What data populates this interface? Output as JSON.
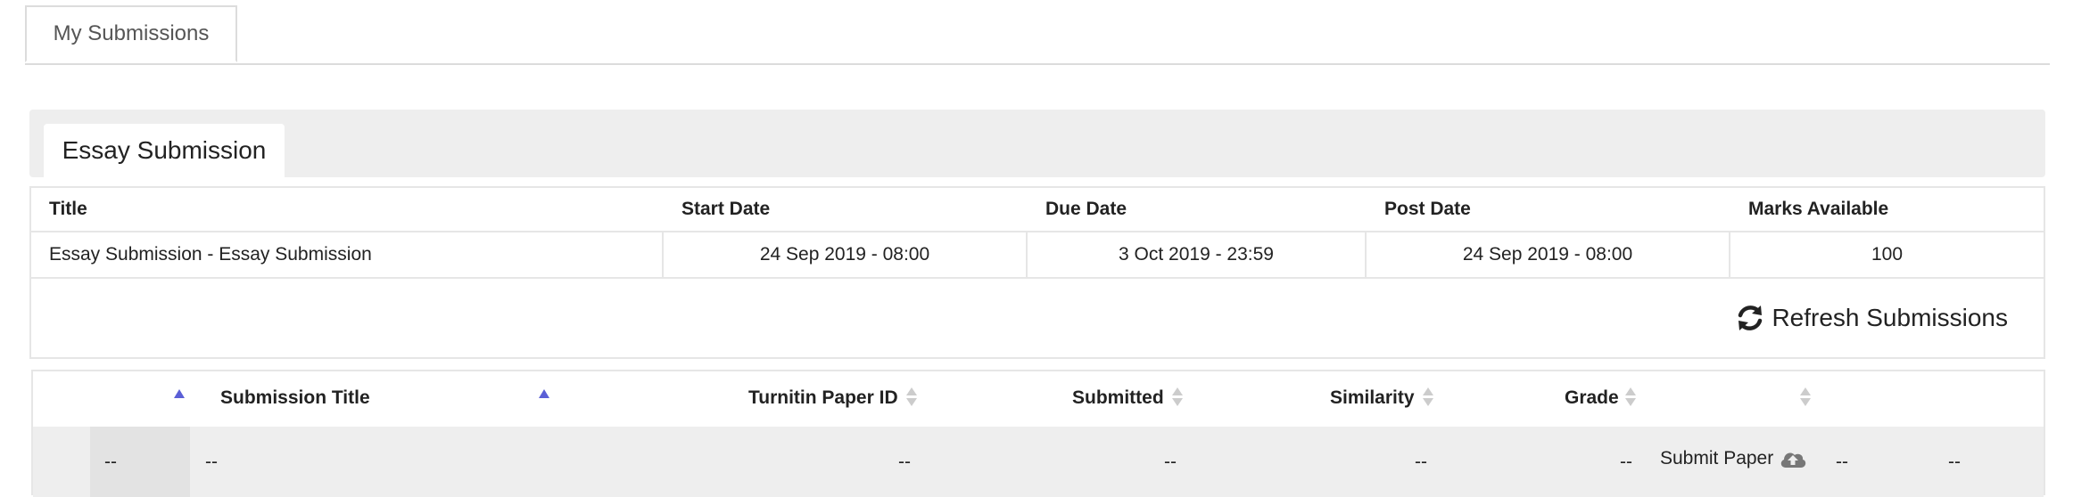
{
  "tabs": {
    "my_submissions": "My Submissions"
  },
  "assignment": {
    "tab_label": "Essay Submission"
  },
  "info_table": {
    "headers": [
      "Title",
      "Start Date",
      "Due Date",
      "Post Date",
      "Marks Available"
    ],
    "row": [
      "Essay Submission - Essay Submission",
      "24 Sep 2019 - 08:00",
      "3 Oct 2019 - 23:59",
      "24 Sep 2019 - 08:00",
      "100"
    ]
  },
  "refresh": {
    "label": "Refresh Submissions",
    "icon": "refresh-icon"
  },
  "submissions_table": {
    "headers": {
      "submission_title": "Submission Title",
      "paper_id": "Turnitin Paper ID",
      "submitted": "Submitted",
      "similarity": "Similarity",
      "grade": "Grade"
    },
    "row": {
      "col1": "--",
      "submission_title": "--",
      "paper_id": "--",
      "submitted": "--",
      "similarity": "--",
      "grade": "--",
      "submit_label": "Submit Paper",
      "col8": "--",
      "col9": "--"
    }
  },
  "colors": {
    "sort_active": "#5b5fd6",
    "sort_inactive": "#cccccc",
    "row_bg": "#eeeeee"
  }
}
